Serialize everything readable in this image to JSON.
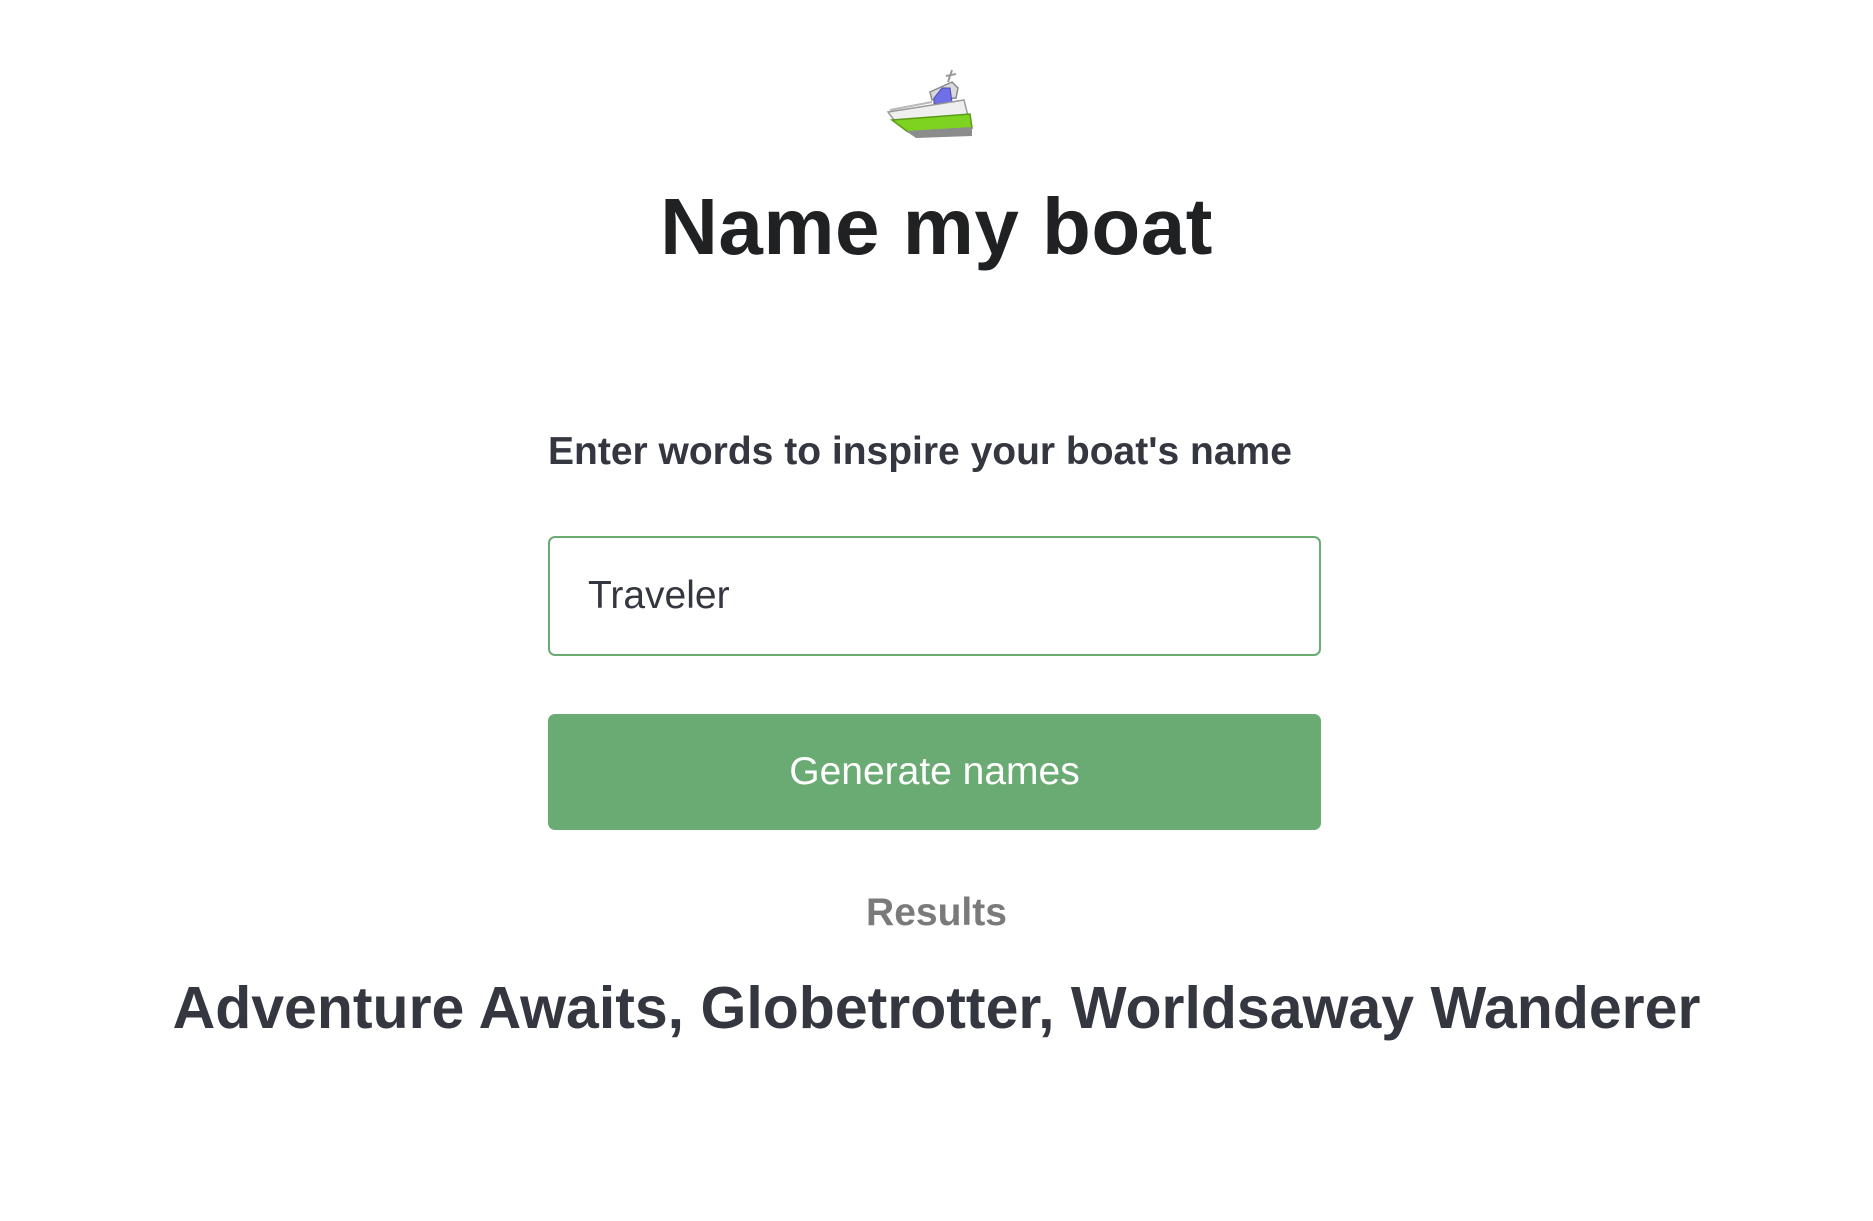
{
  "header": {
    "icon": "motor-boat-icon",
    "title": "Name my boat"
  },
  "form": {
    "label": "Enter words to inspire your boat's name",
    "input_value": "Traveler",
    "button_label": "Generate names"
  },
  "results": {
    "heading": "Results",
    "text": "Adventure Awaits, Globetrotter, Worldsaway Wanderer"
  },
  "colors": {
    "accent": "#6aab73",
    "title_text": "#202123",
    "body_text": "#353740",
    "muted_text": "#7a7a7a"
  }
}
